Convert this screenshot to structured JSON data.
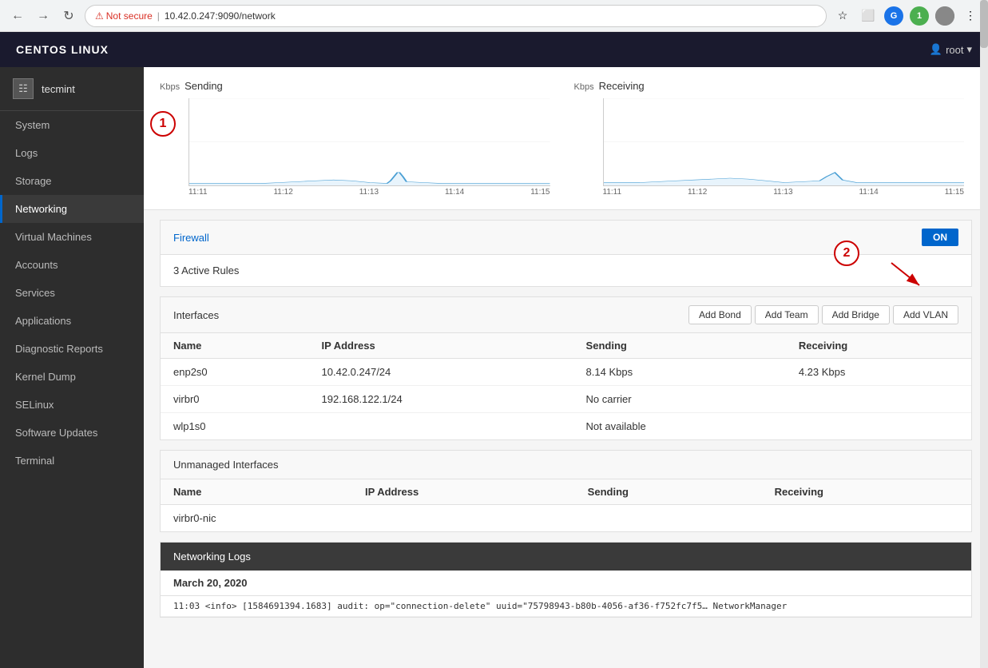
{
  "browser": {
    "url": "10.42.0.247:9090/network",
    "not_secure_label": "Not secure"
  },
  "app": {
    "title": "CENTOS LINUX",
    "user_label": "root"
  },
  "sidebar": {
    "host": "tecmint",
    "items": [
      {
        "id": "system",
        "label": "System"
      },
      {
        "id": "logs",
        "label": "Logs"
      },
      {
        "id": "storage",
        "label": "Storage"
      },
      {
        "id": "networking",
        "label": "Networking",
        "active": true
      },
      {
        "id": "virtual-machines",
        "label": "Virtual Machines"
      },
      {
        "id": "accounts",
        "label": "Accounts"
      },
      {
        "id": "services",
        "label": "Services"
      },
      {
        "id": "applications",
        "label": "Applications"
      },
      {
        "id": "diagnostic-reports",
        "label": "Diagnostic Reports"
      },
      {
        "id": "kernel-dump",
        "label": "Kernel Dump"
      },
      {
        "id": "selinux",
        "label": "SELinux"
      },
      {
        "id": "software-updates",
        "label": "Software Updates"
      },
      {
        "id": "terminal",
        "label": "Terminal"
      }
    ]
  },
  "charts": {
    "sending": {
      "label": "Kbps",
      "title": "Sending",
      "y_values": [
        "800",
        "400",
        "0"
      ],
      "x_labels": [
        "11:11",
        "11:12",
        "11:13",
        "11:14",
        "11:15"
      ]
    },
    "receiving": {
      "label": "Kbps",
      "title": "Receiving",
      "y_values": [
        "800",
        "400",
        "0"
      ],
      "x_labels": [
        "11:11",
        "11:12",
        "11:13",
        "11:14",
        "11:15"
      ]
    }
  },
  "firewall": {
    "link_label": "Firewall",
    "toggle_label": "ON",
    "active_rules": "3 Active Rules"
  },
  "interfaces": {
    "title": "Interfaces",
    "buttons": [
      "Add Bond",
      "Add Team",
      "Add Bridge",
      "Add VLAN"
    ],
    "columns": [
      "Name",
      "IP Address",
      "Sending",
      "Receiving"
    ],
    "rows": [
      {
        "name": "enp2s0",
        "ip": "10.42.0.247/24",
        "sending": "8.14 Kbps",
        "receiving": "4.23 Kbps"
      },
      {
        "name": "virbr0",
        "ip": "192.168.122.1/24",
        "sending": "No carrier",
        "receiving": ""
      },
      {
        "name": "wlp1s0",
        "ip": "",
        "sending": "Not available",
        "receiving": ""
      }
    ]
  },
  "unmanaged_interfaces": {
    "title": "Unmanaged Interfaces",
    "columns": [
      "Name",
      "IP Address",
      "Sending",
      "Receiving"
    ],
    "rows": [
      {
        "name": "virbr0-nic",
        "ip": "",
        "sending": "",
        "receiving": ""
      }
    ]
  },
  "networking_logs": {
    "title": "Networking Logs",
    "date": "March 20, 2020",
    "entries": [
      {
        "text": "11:03  <info> [1584691394.1683] audit: op=\"connection-delete\" uuid=\"75798943-b80b-4056-af36-f752fc7f5…   NetworkManager"
      }
    ]
  },
  "annotations": {
    "circle1_label": "1",
    "circle2_label": "2"
  }
}
